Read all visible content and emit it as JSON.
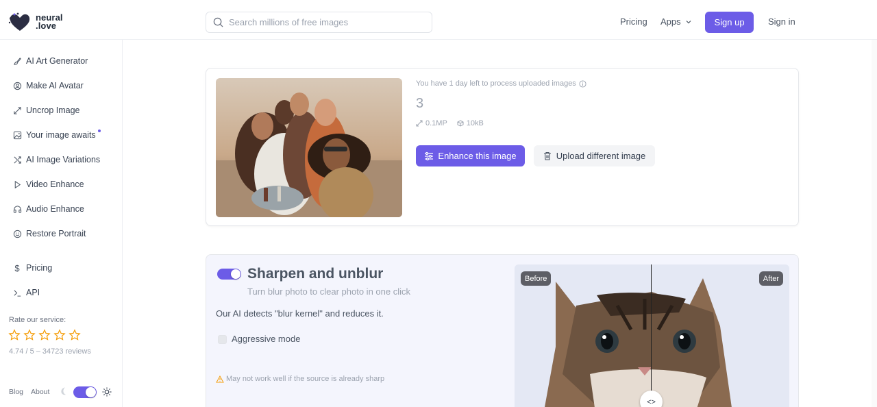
{
  "header": {
    "logo_line1": "neural",
    "logo_line2": ".love",
    "search_placeholder": "Search millions of free images",
    "pricing": "Pricing",
    "apps": "Apps",
    "signup": "Sign up",
    "signin": "Sign in"
  },
  "sidebar": {
    "items": [
      {
        "label": "AI Art Generator",
        "icon": "brush-icon"
      },
      {
        "label": "Make AI Avatar",
        "icon": "avatar-icon"
      },
      {
        "label": "Uncrop Image",
        "icon": "expand-icon"
      },
      {
        "label": "Your image awaits",
        "icon": "image-icon"
      },
      {
        "label": "AI Image Variations",
        "icon": "shuffle-icon"
      },
      {
        "label": "Video Enhance",
        "icon": "play-icon"
      },
      {
        "label": "Audio Enhance",
        "icon": "headphones-icon"
      },
      {
        "label": "Restore Portrait",
        "icon": "smile-icon"
      }
    ],
    "secondary": [
      {
        "label": "Pricing",
        "icon": "dollar-icon"
      },
      {
        "label": "API",
        "icon": "terminal-icon"
      }
    ],
    "rate_label": "Rate our service:",
    "reviews": "4.74 / 5 – 34723 reviews",
    "stars_count": 5,
    "blog": "Blog",
    "about": "About"
  },
  "upload_card": {
    "days_left": "You have 1 day left to process uploaded images",
    "file_name": "3",
    "resolution": "0.1MP",
    "file_size": "10kB",
    "enhance_button": "Enhance this image",
    "upload_button": "Upload different image"
  },
  "feature_card": {
    "title": "Sharpen and unblur",
    "subtitle": "Turn blur photo to clear photo in one click",
    "description": "Our AI detects \"blur kernel\" and reduces it.",
    "aggressive": "Aggressive mode",
    "warning": "May not work well if the source is already sharp",
    "before": "Before",
    "after": "After"
  },
  "colors": {
    "accent": "#6c5ce7",
    "star": "#f59e0b"
  }
}
